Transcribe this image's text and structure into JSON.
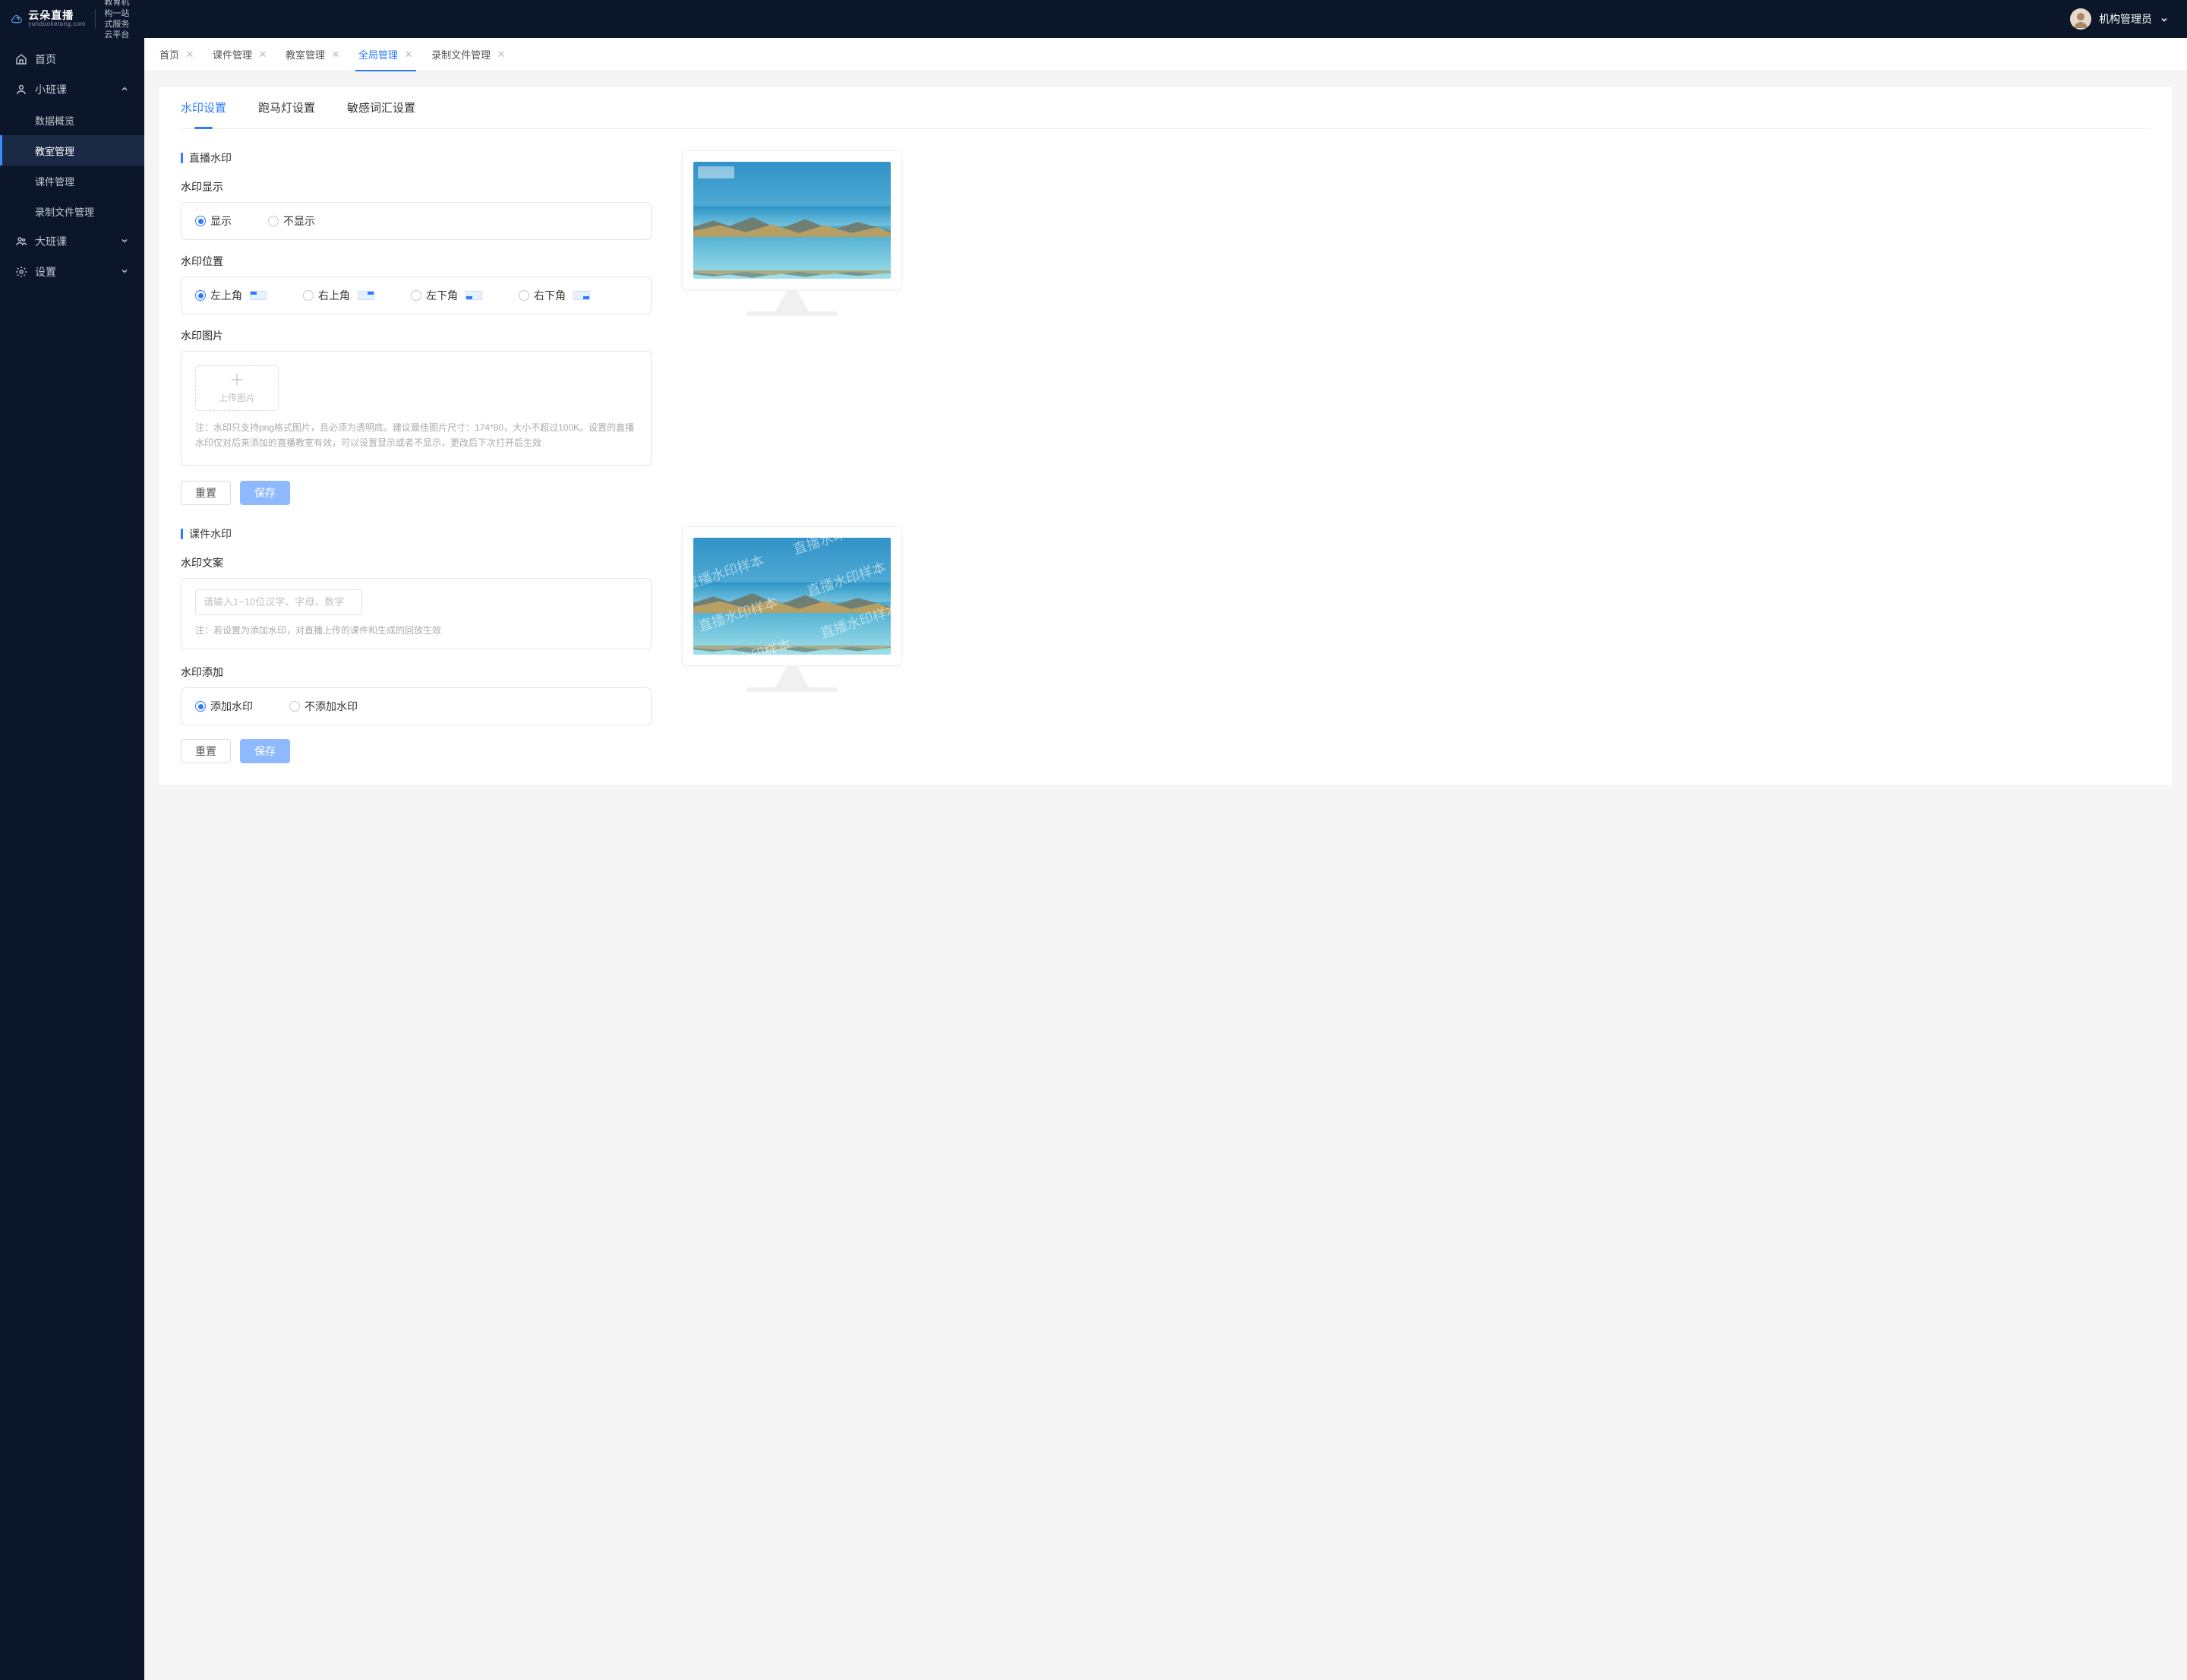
{
  "brand": {
    "title": "云朵直播",
    "subtitle": "yunduoketang.com",
    "tagline_line1": "教育机构一站",
    "tagline_line2": "式服务云平台"
  },
  "user": {
    "name": "机构管理员"
  },
  "sidebar": {
    "items": [
      {
        "key": "home",
        "label": "首页",
        "icon": "home",
        "level": 1
      },
      {
        "key": "small",
        "label": "小班课",
        "icon": "class",
        "level": 1,
        "expanded": true
      },
      {
        "key": "overview",
        "label": "数据概览",
        "level": 2
      },
      {
        "key": "classroom",
        "label": "教室管理",
        "level": 2,
        "active": true
      },
      {
        "key": "courseware",
        "label": "课件管理",
        "level": 2
      },
      {
        "key": "recordings",
        "label": "录制文件管理",
        "level": 2
      },
      {
        "key": "big",
        "label": "大班课",
        "icon": "class-big",
        "level": 1,
        "collapsed": true
      },
      {
        "key": "settings",
        "label": "设置",
        "icon": "gear",
        "level": 1,
        "collapsed": true
      }
    ]
  },
  "tabs": [
    {
      "label": "首页",
      "closable": true
    },
    {
      "label": "课件管理",
      "closable": true
    },
    {
      "label": "教室管理",
      "closable": true
    },
    {
      "label": "全局管理",
      "closable": true,
      "active": true
    },
    {
      "label": "录制文件管理",
      "closable": true
    }
  ],
  "inner_tabs": [
    {
      "label": "水印设置",
      "active": true
    },
    {
      "label": "跑马灯设置"
    },
    {
      "label": "敏感词汇设置"
    }
  ],
  "section_live": {
    "title": "直播水印",
    "display_label": "水印显示",
    "display_options": {
      "show": "显示",
      "hide": "不显示"
    },
    "display_value": "show",
    "position_label": "水印位置",
    "position_options": {
      "tl": "左上角",
      "tr": "右上角",
      "bl": "左下角",
      "br": "右下角"
    },
    "position_value": "tl",
    "image_label": "水印图片",
    "upload_label": "上传图片",
    "upload_note": "注：水印只支持png格式图片，且必须为透明底。建议最佳图片尺寸：174*80，大小不超过100K。设置的直播水印仅对后来添加的直播教室有效，可以设置显示或者不显示，更改后下次打开后生效",
    "reset": "重置",
    "save": "保存"
  },
  "section_courseware": {
    "title": "课件水印",
    "text_label": "水印文案",
    "text_placeholder": "请输入1~10位汉字、字母、数字",
    "text_note": "注：若设置为添加水印，对直播上传的课件和生成的回放生效",
    "add_label": "水印添加",
    "add_options": {
      "add": "添加水印",
      "none": "不添加水印"
    },
    "add_value": "add",
    "reset": "重置",
    "save": "保存",
    "sample_text": "直播水印样本"
  }
}
